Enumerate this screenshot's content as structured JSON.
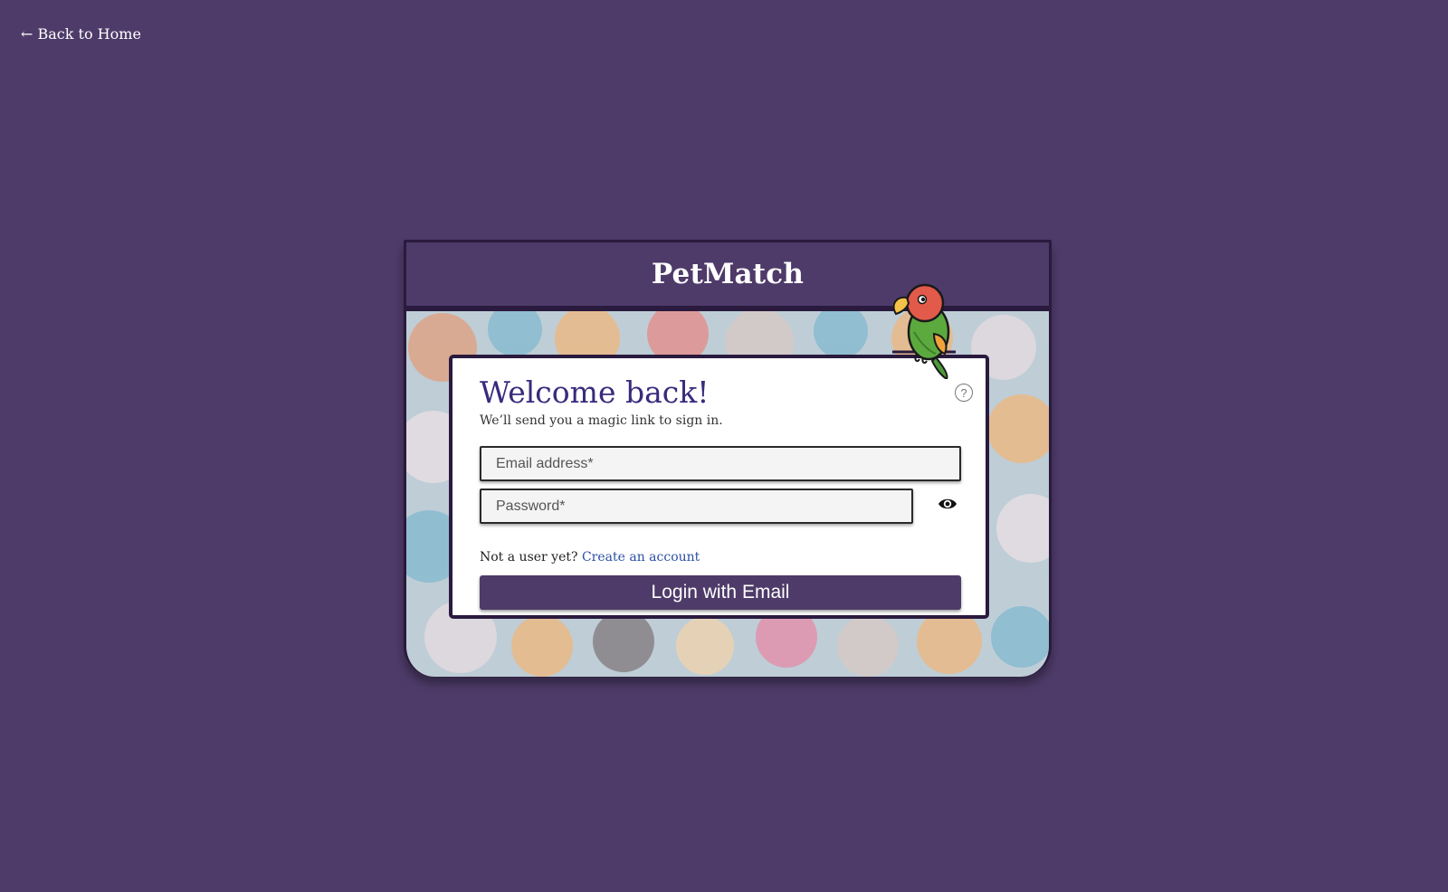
{
  "nav": {
    "back_label": "← Back to Home"
  },
  "brand": {
    "name": "PetMatch"
  },
  "login": {
    "heading": "Welcome back!",
    "subtitle": "We’ll send you a magic link to sign in.",
    "help_icon": "question-circle-icon",
    "help_glyph": "?",
    "email": {
      "placeholder": "Email address*",
      "value": ""
    },
    "password": {
      "placeholder": "Password*",
      "value": ""
    },
    "show_password_icon": "eye-icon",
    "signup_prompt": "Not a user yet?",
    "signup_link": "Create an account",
    "submit_label": "Login with Email"
  },
  "mascot_icon": "parrot-icon",
  "colors": {
    "page_bg": "#4e3b69",
    "header_bg": "#4e3b69",
    "border": "#2a1a3e",
    "heading": "#3a2a7c",
    "link": "#2b4fa3",
    "button_bg": "#4e3b69"
  }
}
